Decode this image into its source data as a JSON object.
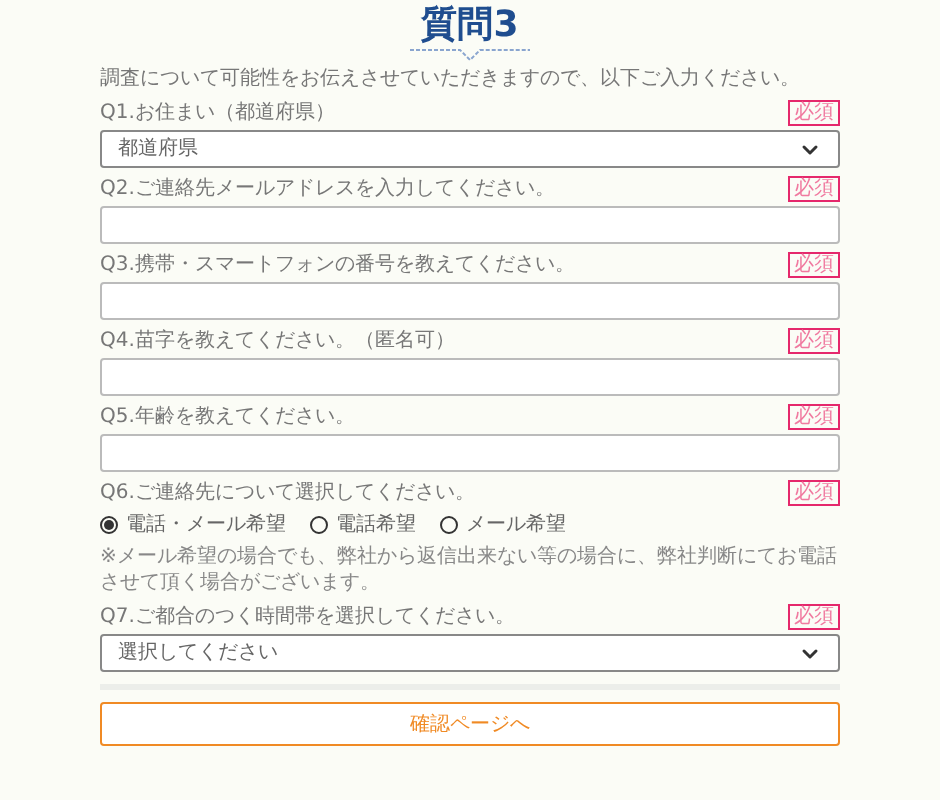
{
  "title": "質問3",
  "intro": "調査について可能性をお伝えさせていただきますので、以下ご入力ください。",
  "questions": [
    {
      "kind": "select",
      "label": "Q1.お住まい（都道府県）",
      "badge": "必須",
      "value": "都道府県"
    },
    {
      "kind": "text",
      "label": "Q2.ご連絡先メールアドレスを入力してください。",
      "badge": "必須"
    },
    {
      "kind": "text",
      "label": "Q3.携帯・スマートフォンの番号を教えてください。",
      "badge": "必須"
    },
    {
      "kind": "text",
      "label": "Q4.苗字を教えてください。（匿名可）",
      "badge": "必須"
    },
    {
      "kind": "text",
      "label": "Q5.年齢を教えてください。",
      "badge": "必須"
    },
    {
      "kind": "radio",
      "label": "Q6.ご連絡先について選択してください。",
      "badge": "必須",
      "options": [
        {
          "label": "電話・メール希望",
          "selected": true
        },
        {
          "label": "電話希望",
          "selected": false
        },
        {
          "label": "メール希望",
          "selected": false
        }
      ],
      "note": "※メール希望の場合でも、弊社から返信出来ない等の場合に、弊社判断にてお電話させて頂く場合がございます。"
    },
    {
      "kind": "select",
      "label": "Q7.ご都合のつく時間帯を選択してください。",
      "badge": "必須",
      "value": "選択してください"
    }
  ],
  "submit": "確認ページへ"
}
